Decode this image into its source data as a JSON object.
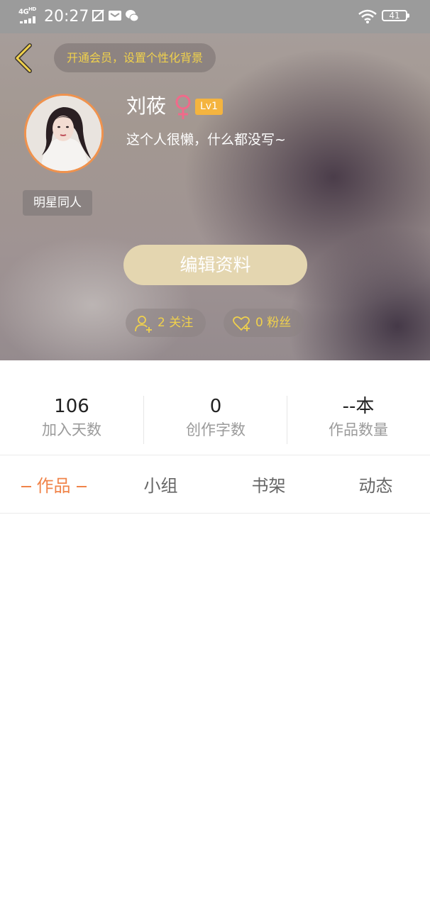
{
  "status_bar": {
    "network": "4G",
    "network_hd": "HD",
    "time": "20:27",
    "battery": "41"
  },
  "profile": {
    "vip_banner": "开通会员，设置个性化背景",
    "name": "刘莜",
    "level": "Lv1",
    "bio": "这个人很懒，什么都没写~",
    "tag": "明星同人",
    "edit_button": "编辑资料",
    "following": "2 关注",
    "fans": "0 粉丝"
  },
  "stats": [
    {
      "value": "106",
      "label": "加入天数"
    },
    {
      "value": "0",
      "label": "创作字数"
    },
    {
      "value": "--本",
      "label": "作品数量"
    }
  ],
  "tabs": [
    {
      "label": "作品",
      "active": true
    },
    {
      "label": "小组",
      "active": false
    },
    {
      "label": "书架",
      "active": false
    },
    {
      "label": "动态",
      "active": false
    }
  ],
  "colors": {
    "accent": "#f0844a",
    "vip_gold": "#f0d14c",
    "level_badge": "#f4b43f",
    "gender_female": "#f06a8a"
  }
}
